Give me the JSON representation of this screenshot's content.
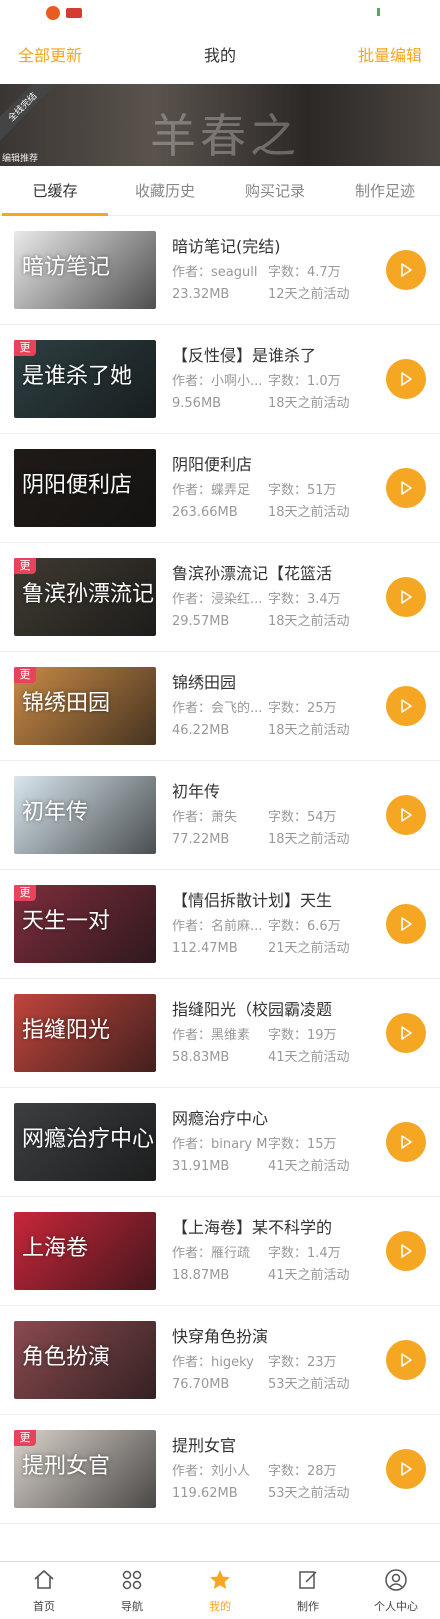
{
  "header": {
    "left": "全部更新",
    "title": "我的",
    "right": "批量编辑"
  },
  "banner": {
    "ribbon": "全线完结",
    "title": "羊春之",
    "tag": "编辑推荐"
  },
  "tabs": [
    {
      "label": "已缓存",
      "active": true
    },
    {
      "label": "收藏历史",
      "active": false
    },
    {
      "label": "购买记录",
      "active": false
    },
    {
      "label": "制作足迹",
      "active": false
    }
  ],
  "items": [
    {
      "title": "暗访笔记(完结)",
      "author": "作者：seagull",
      "words": "字数：4.7万",
      "size": "23.32MB",
      "active": "12天之前活动",
      "cover_label": "暗访笔记",
      "update": "",
      "color": "#e9e9e9"
    },
    {
      "title": "【反性侵】是谁杀了",
      "author": "作者：小啊小...",
      "words": "字数：1.0万",
      "size": "9.56MB",
      "active": "18天之前活动",
      "cover_label": "是谁杀了她",
      "update": "更",
      "color": "#2d3f42"
    },
    {
      "title": "阴阳便利店",
      "author": "作者：蝶弄足",
      "words": "字数：51万",
      "size": "263.66MB",
      "active": "18天之前活动",
      "cover_label": "阴阳便利店",
      "update": "",
      "color": "#1f1a17"
    },
    {
      "title": "鲁滨孙漂流记【花篮活",
      "author": "作者：浸染红...",
      "words": "字数：3.4万",
      "size": "29.57MB",
      "active": "18天之前活动",
      "cover_label": "鲁滨孙漂流记",
      "update": "更",
      "color": "#3f3a32"
    },
    {
      "title": "锦绣田园",
      "author": "作者：会飞的...",
      "words": "字数：25万",
      "size": "46.22MB",
      "active": "18天之前活动",
      "cover_label": "锦绣田园",
      "update": "更",
      "color": "#c98a46"
    },
    {
      "title": "初年传",
      "author": "作者：萧失",
      "words": "字数：54万",
      "size": "77.22MB",
      "active": "18天之前活动",
      "cover_label": "初年传",
      "update": "",
      "color": "#d8e6ee"
    },
    {
      "title": "【情侣拆散计划】天生",
      "author": "作者：名前麻...",
      "words": "字数：6.6万",
      "size": "112.47MB",
      "active": "21天之前活动",
      "cover_label": "天生一对",
      "update": "更",
      "color": "#7d2d3c"
    },
    {
      "title": "指缝阳光（校园霸凌题",
      "author": "作者：黑维素",
      "words": "字数：19万",
      "size": "58.83MB",
      "active": "41天之前活动",
      "cover_label": "指缝阳光",
      "update": "",
      "color": "#c0453c"
    },
    {
      "title": "网瘾治疗中心",
      "author": "作者：binary M",
      "words": "字数：15万",
      "size": "31.91MB",
      "active": "41天之前活动",
      "cover_label": "网瘾治疗中心",
      "update": "",
      "color": "#3c3e40"
    },
    {
      "title": "【上海卷】某不科学的",
      "author": "作者：雁行疏",
      "words": "字数：1.4万",
      "size": "18.87MB",
      "active": "41天之前活动",
      "cover_label": "上海卷",
      "update": "",
      "color": "#c8263a"
    },
    {
      "title": "快穿角色扮演",
      "author": "作者：higeky",
      "words": "字数：23万",
      "size": "76.70MB",
      "active": "53天之前活动",
      "cover_label": "角色扮演",
      "update": "",
      "color": "#8b4a4f"
    },
    {
      "title": "提刑女官",
      "author": "作者：刘小人",
      "words": "字数：28万",
      "size": "119.62MB",
      "active": "53天之前活动",
      "cover_label": "提刑女官",
      "update": "更",
      "color": "#d9d2cb"
    }
  ],
  "bottom_nav": [
    {
      "label": "首页",
      "icon": "home-icon",
      "active": false
    },
    {
      "label": "导航",
      "icon": "grid-icon",
      "active": false
    },
    {
      "label": "我的",
      "icon": "star-icon",
      "active": true
    },
    {
      "label": "制作",
      "icon": "edit-icon",
      "active": false
    },
    {
      "label": "个人中心",
      "icon": "user-icon",
      "active": false
    }
  ]
}
